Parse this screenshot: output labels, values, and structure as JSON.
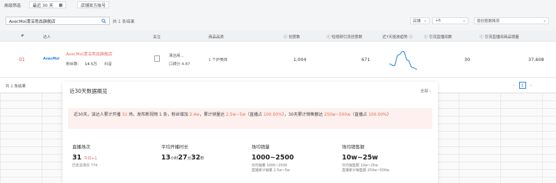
{
  "topbar": {
    "advanced_filter": "高级筛选",
    "date_range": "最近 30 天",
    "shop_tag": "店铺官方账号"
  },
  "search": {
    "value": "AvecMoi清洁用品旗舰店",
    "result_count": "共 1 条结果"
  },
  "filters": {
    "shop": "店铺",
    "plus": "+6",
    "sort": "按创意数降序"
  },
  "table": {
    "headers": [
      "#",
      "达人",
      "关注",
      "商品品类",
      "创意数",
      "短视频引流创意数",
      "近7天投放趋势",
      "引流直播间数",
      "引流直播间商品销量"
    ],
    "row": {
      "rank": "01",
      "logo": "AvecMoi",
      "name": "AvecMoi清洁用品旗舰店",
      "fans_label": "粉丝数:",
      "fans_value": "14.5万",
      "platform": "抖音",
      "trunc_a": "清洁用...",
      "trunc_b": "口碑分 4.87",
      "category": "1 个护美体",
      "creatives": "1,004",
      "short_video": "671",
      "live_rooms": "30",
      "live_sales": "37,608"
    },
    "footer_count": "共 1 条结果",
    "page": "1"
  },
  "panel": {
    "title": "近30天数据概览",
    "all_label": "全部 ›",
    "summary": {
      "p1": "近30天，该达人累计开播 ",
      "live_count": "31",
      "p2": " 场，发布新视频 1 条，粉丝增加 ",
      "fans_add": "2.4w",
      "p3": "，累计销量达 ",
      "sales": "2.5w~5w",
      "p4": "（直播占 ",
      "pct1": "100.00%",
      "p5": "），30天累计销售额达 ",
      "amount": "250w~500w",
      "p6": "（直播占 ",
      "pct2": "100.00%",
      "p7": "）"
    },
    "stats": [
      {
        "label": "直播场次",
        "value": "31",
        "extra": "今日+1",
        "sub1": "历史总场次 774",
        "sub2": ""
      },
      {
        "label": "平均开播时长",
        "h": "13",
        "hu": "小时",
        "m": "27",
        "mu": "分",
        "s": "32",
        "su": "秒",
        "sub1": "",
        "sub2": ""
      },
      {
        "label": "场均销量",
        "value": "1000~2500",
        "sub1": "日均销量 1000~2500",
        "sub2": "直播累计销量 2.5w~5w"
      },
      {
        "label": "场均销售额",
        "value": "10w~25w",
        "sub1": "日均销售额 10w~25w",
        "sub2": "直播累计销售额 250w~500w"
      }
    ]
  },
  "chart_data": {
    "type": "line",
    "x": [
      1,
      2,
      3,
      4,
      5,
      6,
      7
    ],
    "values": [
      60,
      55,
      85,
      95,
      70,
      50,
      45
    ],
    "color": "#3a8ee6"
  }
}
